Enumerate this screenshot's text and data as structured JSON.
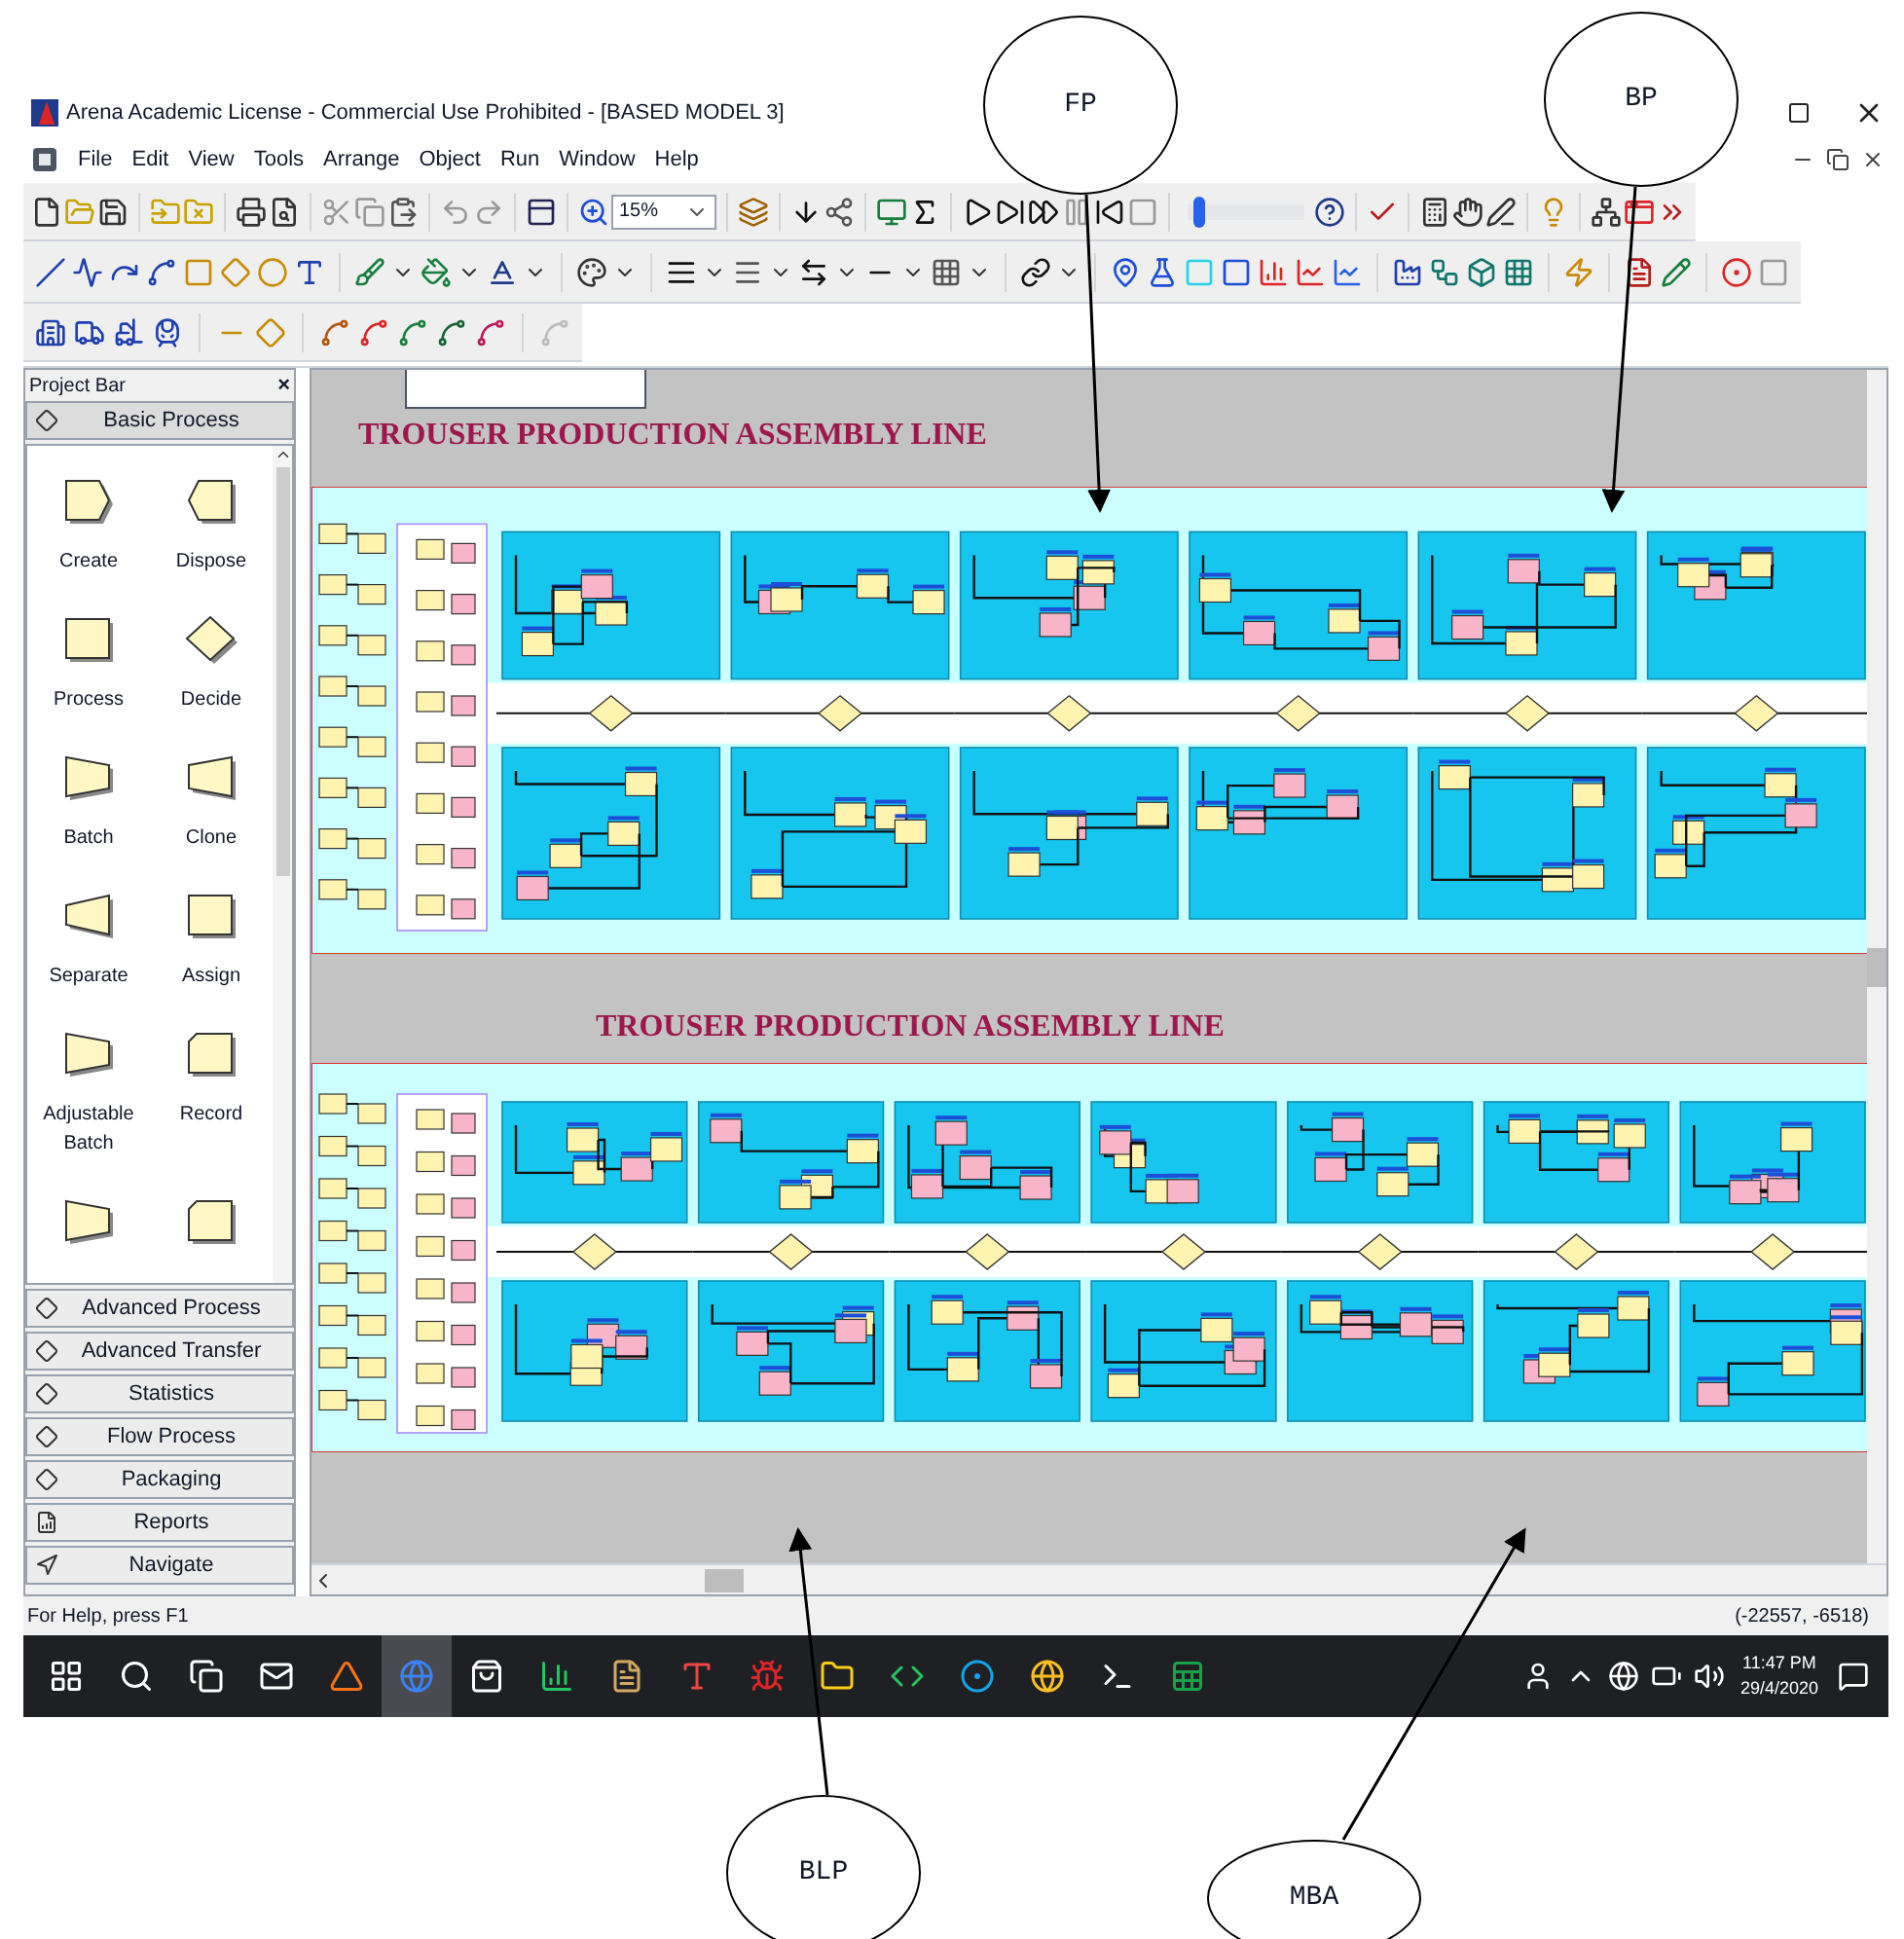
{
  "window": {
    "title": "Arena Academic License - Commercial Use Prohibited - [BASED MODEL 3]"
  },
  "menu": [
    "File",
    "Edit",
    "View",
    "Tools",
    "Arrange",
    "Object",
    "Run",
    "Window",
    "Help"
  ],
  "toolbar": {
    "zoom": "15%",
    "speed_slider": {
      "level": 0.05
    }
  },
  "project_bar": {
    "title": "Project Bar",
    "close": "×",
    "panels": [
      {
        "label": "Basic Process",
        "kind": "template",
        "expanded": true,
        "modules": [
          {
            "label": "Create",
            "kind": "create"
          },
          {
            "label": "Dispose",
            "kind": "dispose"
          },
          {
            "label": "Process",
            "kind": "process"
          },
          {
            "label": "Decide",
            "kind": "decide"
          },
          {
            "label": "Batch",
            "kind": "batch"
          },
          {
            "label": "Clone",
            "kind": "clone"
          },
          {
            "label": "Separate",
            "kind": "separate"
          },
          {
            "label": "Assign",
            "kind": "process"
          },
          {
            "label": "Adjustable Batch",
            "kind": "batch"
          },
          {
            "label": "Record",
            "kind": "record"
          },
          {
            "kind": "batch"
          },
          {
            "kind": "record"
          }
        ]
      },
      {
        "label": "Advanced Process",
        "kind": "template",
        "expanded": false
      },
      {
        "label": "Advanced Transfer",
        "kind": "template",
        "expanded": false
      },
      {
        "label": "Statistics",
        "kind": "template",
        "expanded": false
      },
      {
        "label": "Flow Process",
        "kind": "template",
        "expanded": false
      },
      {
        "label": "Packaging",
        "kind": "template",
        "expanded": false
      },
      {
        "label": "Reports",
        "kind": "reports",
        "expanded": false
      },
      {
        "label": "Navigate",
        "kind": "navigate",
        "expanded": false
      }
    ]
  },
  "canvas": {
    "sections": [
      {
        "title": "TROUSER PRODUCTION ASSEMBLY LINE"
      },
      {
        "title": "TROUSER PRODUCTION ASSEMBLY LINE"
      }
    ]
  },
  "status_bar": {
    "help": "For Help, press F1",
    "coordinates": "(-22557, -6518)"
  },
  "taskbar": {
    "apps": [
      {
        "selected": false
      },
      {
        "selected": false
      },
      {
        "selected": false
      },
      {
        "selected": false
      },
      {
        "selected": false
      },
      {
        "selected": true
      },
      {
        "selected": false
      },
      {
        "selected": false
      },
      {
        "selected": false
      },
      {
        "selected": false
      },
      {
        "selected": false
      },
      {
        "selected": false
      },
      {
        "selected": false
      },
      {
        "selected": false
      },
      {
        "selected": false
      },
      {
        "selected": false
      },
      {
        "selected": false
      }
    ],
    "time": "11:47 PM",
    "date": "29/4/2020"
  },
  "callouts": [
    {
      "label": "FP"
    },
    {
      "label": "BP"
    },
    {
      "label": "BLP"
    },
    {
      "label": "MBA"
    }
  ]
}
